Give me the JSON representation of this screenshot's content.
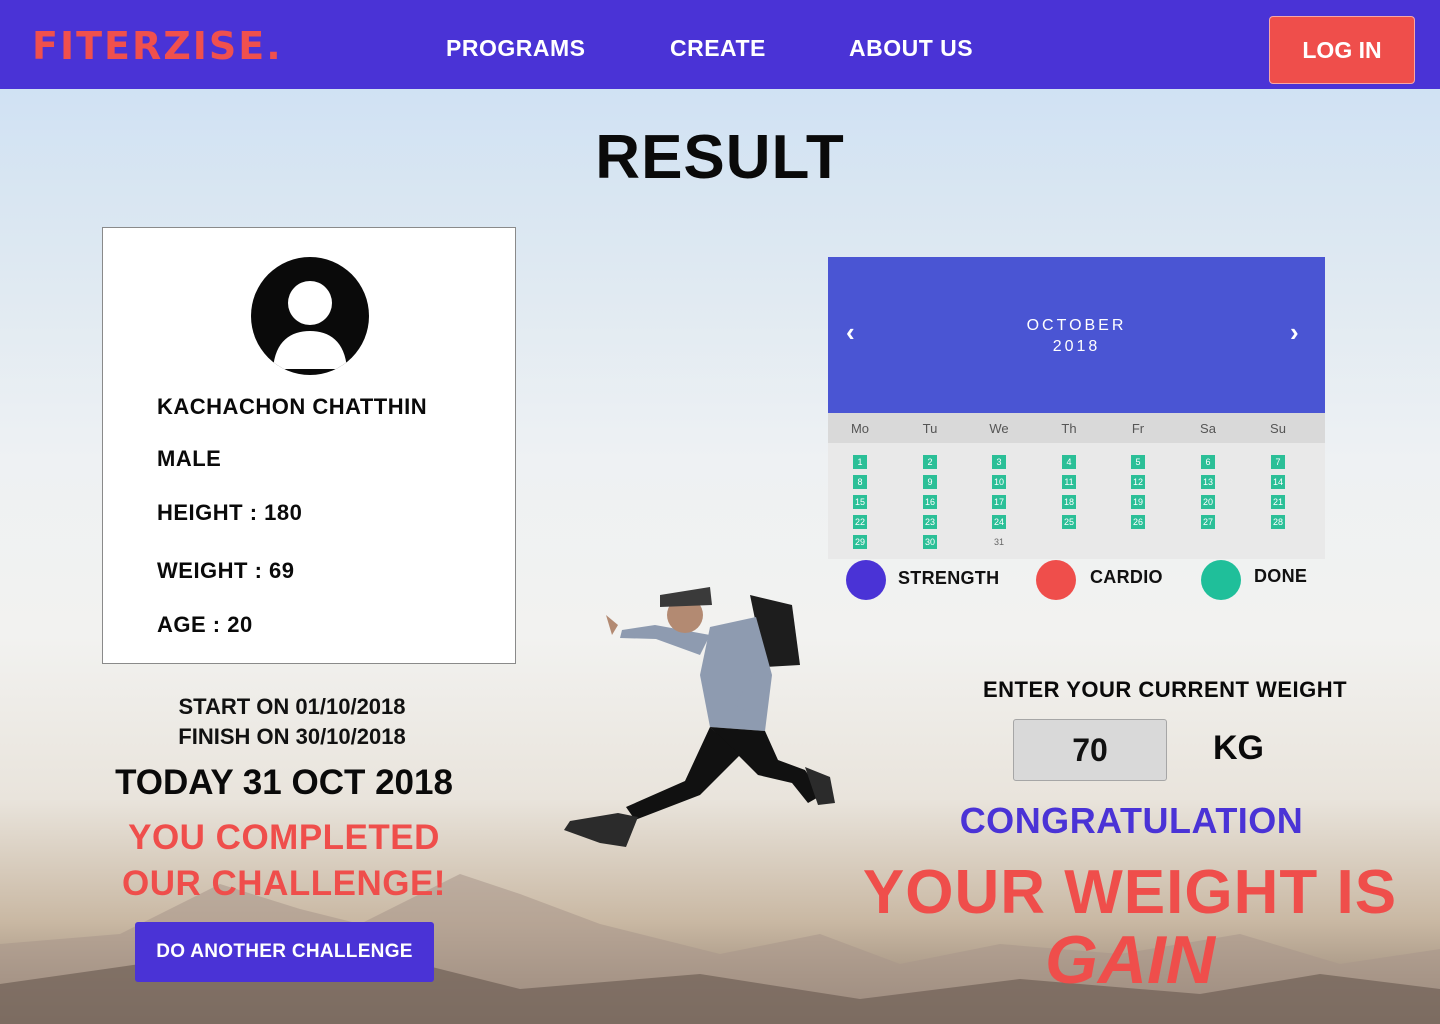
{
  "brand": {
    "logo": "FITERZISE."
  },
  "nav": {
    "links": [
      "PROGRAMS",
      "CREATE",
      "ABOUT US"
    ],
    "login": "LOG IN"
  },
  "page": {
    "title": "RESULT"
  },
  "profile": {
    "name": "KACHACHON CHATTHIN",
    "gender": "MALE",
    "height": "HEIGHT : 180",
    "weight": "WEIGHT : 69",
    "age": "AGE : 20"
  },
  "challenge": {
    "start": "START ON 01/10/2018",
    "finish": "FINISH ON 30/10/2018",
    "today": "TODAY 31 OCT 2018",
    "completed_line1": "YOU COMPLETED",
    "completed_line2": "OUR CHALLENGE!",
    "button": "DO ANOTHER CHALLENGE"
  },
  "calendar": {
    "month": "OCTOBER",
    "year": "2018",
    "prev": "‹",
    "next": "›",
    "weekdays": [
      "Mo",
      "Tu",
      "We",
      "Th",
      "Fr",
      "Sa",
      "Su"
    ],
    "done_days": [
      1,
      2,
      3,
      4,
      5,
      6,
      7,
      8,
      9,
      10,
      11,
      12,
      13,
      14,
      15,
      16,
      17,
      18,
      19,
      20,
      21,
      22,
      23,
      24,
      25,
      26,
      27,
      28,
      29,
      30
    ],
    "other_days": [
      31
    ]
  },
  "legend": [
    {
      "label": "STRENGTH",
      "color": "#4a33d6"
    },
    {
      "label": "CARDIO",
      "color": "#ef4e4b"
    },
    {
      "label": "DONE",
      "color": "#1fbf9a"
    }
  ],
  "weight_entry": {
    "label": "ENTER YOUR CURRENT WEIGHT",
    "value": "70",
    "unit": "KG"
  },
  "result": {
    "congrats": "CONGRATULATION",
    "line1": "YOUR WEIGHT IS",
    "line2": "GAIN"
  },
  "colors": {
    "primary": "#4a33d6",
    "accent": "#ef4e4b",
    "done": "#2bbf97"
  }
}
